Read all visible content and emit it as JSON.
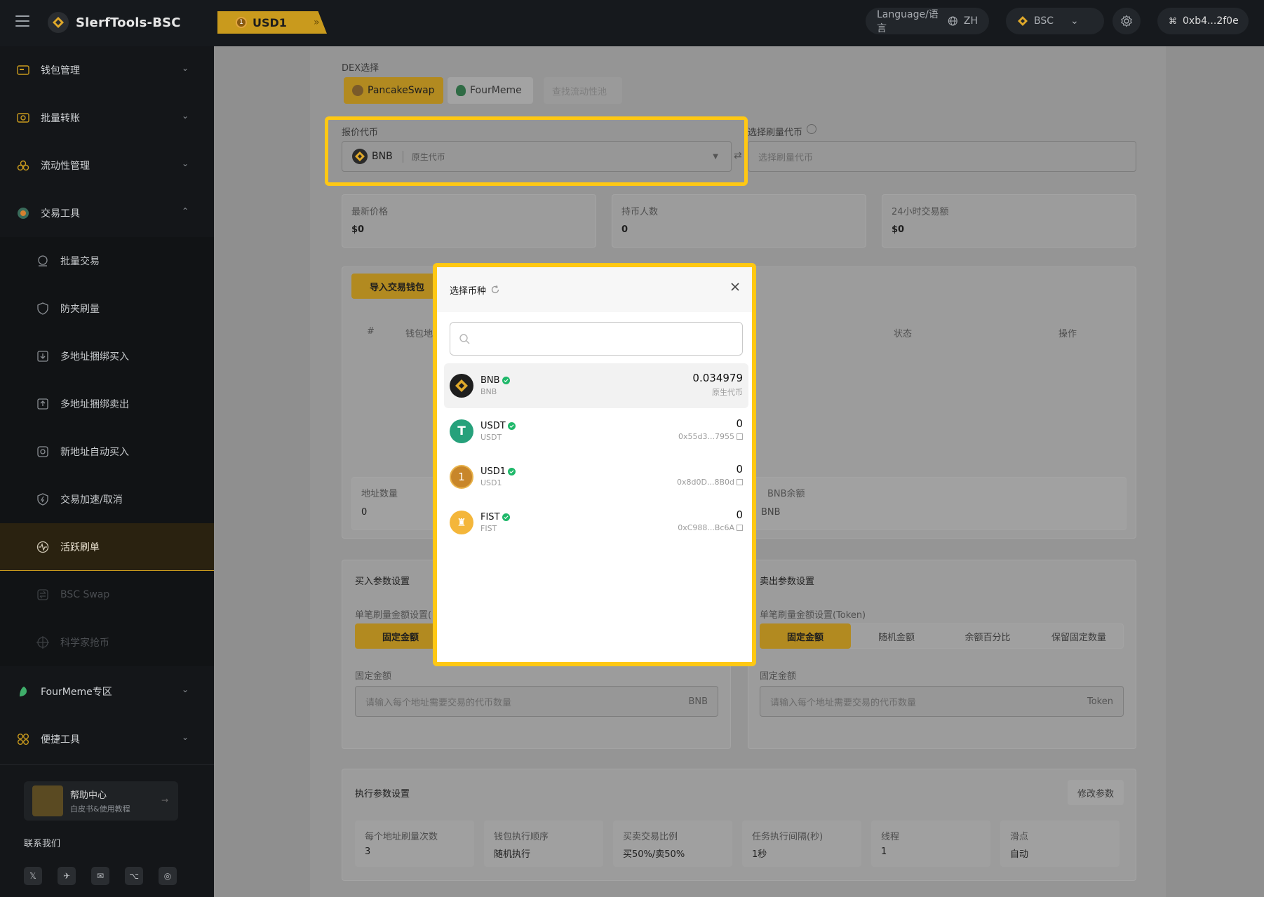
{
  "app": {
    "title": "SlerfTools-BSC"
  },
  "topbar": {
    "active_tab": "USD1",
    "language_label": "Language/语言",
    "language_code": "ZH",
    "network": "BSC",
    "wallet_address": "0xb4...2f0e"
  },
  "sidebar": {
    "groups": [
      {
        "label": "钱包管理"
      },
      {
        "label": "批量转账"
      },
      {
        "label": "流动性管理"
      },
      {
        "label": "交易工具"
      }
    ],
    "subitems": [
      {
        "label": "批量交易"
      },
      {
        "label": "防夹刷量"
      },
      {
        "label": "多地址捆绑买入"
      },
      {
        "label": "多地址捆绑卖出"
      },
      {
        "label": "新地址自动买入"
      },
      {
        "label": "交易加速/取消"
      },
      {
        "label": "活跃刷单"
      },
      {
        "label": "BSC Swap"
      },
      {
        "label": "科学家抢币"
      }
    ],
    "groups2": [
      {
        "label": "FourMeme专区"
      },
      {
        "label": "便捷工具"
      }
    ],
    "help": {
      "title": "帮助中心",
      "subtitle": "白皮书&使用教程"
    },
    "contact_label": "联系我们",
    "socials": [
      "𝕏",
      "✈",
      "✉",
      "⌥",
      "◎"
    ]
  },
  "main": {
    "dex_label": "DEX选择",
    "dex_options": [
      "PancakeSwap",
      "FourMeme"
    ],
    "find_pool": "查找流动性池",
    "quote_label": "报价代币",
    "quote_token": "BNB",
    "quote_token_desc": "原生代币",
    "select_token_label": "选择刷量代币",
    "select_token_placeholder": "选择刷量代币",
    "stats": [
      {
        "label": "最新价格",
        "value": "$0"
      },
      {
        "label": "持币人数",
        "value": "0"
      },
      {
        "label": "24小时交易额",
        "value": "$0"
      }
    ],
    "import_wallet": "导入交易钱包",
    "table_headers": {
      "idx": "#",
      "addr": "钱包地",
      "status": "状态",
      "ops": "操作"
    },
    "addr_count_label": "地址数量",
    "addr_count_value": "0",
    "bnb_balance_label": "BNB余额",
    "bnb_balance_value": "BNB",
    "buy": {
      "title": "买入参数设置",
      "amount_label": "单笔刷量金额设置(",
      "seg_on": "固定金额",
      "fixed_label": "固定金额",
      "placeholder": "请输入每个地址需要交易的代币数量",
      "unit": "BNB"
    },
    "sell": {
      "title": "卖出参数设置",
      "amount_label": "单笔刷量金额设置(Token)",
      "segs": [
        "固定金额",
        "随机金额",
        "余额百分比",
        "保留固定数量"
      ],
      "fixed_label": "固定金额",
      "placeholder": "请输入每个地址需要交易的代币数量",
      "unit": "Token"
    },
    "exec": {
      "title": "执行参数设置",
      "modify": "修改参数",
      "params": [
        {
          "label": "每个地址刷量次数",
          "value": "3"
        },
        {
          "label": "钱包执行顺序",
          "value": "随机执行"
        },
        {
          "label": "买卖交易比例",
          "value": "买50%/卖50%"
        },
        {
          "label": "任务执行间隔(秒)",
          "value": "1秒"
        },
        {
          "label": "线程",
          "value": "1"
        },
        {
          "label": "滑点",
          "value": "自动"
        }
      ]
    }
  },
  "modal": {
    "title": "选择币种",
    "search_placeholder": "",
    "tokens": [
      {
        "name": "BNB",
        "symbol": "BNB",
        "balance": "0.034979",
        "sub": "原生代币"
      },
      {
        "name": "USDT",
        "symbol": "USDT",
        "balance": "0",
        "sub": "0x55d3...7955"
      },
      {
        "name": "USD1",
        "symbol": "USD1",
        "balance": "0",
        "sub": "0x8d0D...8B0d"
      },
      {
        "name": "FIST",
        "symbol": "FIST",
        "balance": "0",
        "sub": "0xC988...Bc6A"
      }
    ]
  },
  "colors": {
    "accent": "#ffc813",
    "brand_gold": "#c99a1d",
    "verified": "#1fb86a"
  }
}
